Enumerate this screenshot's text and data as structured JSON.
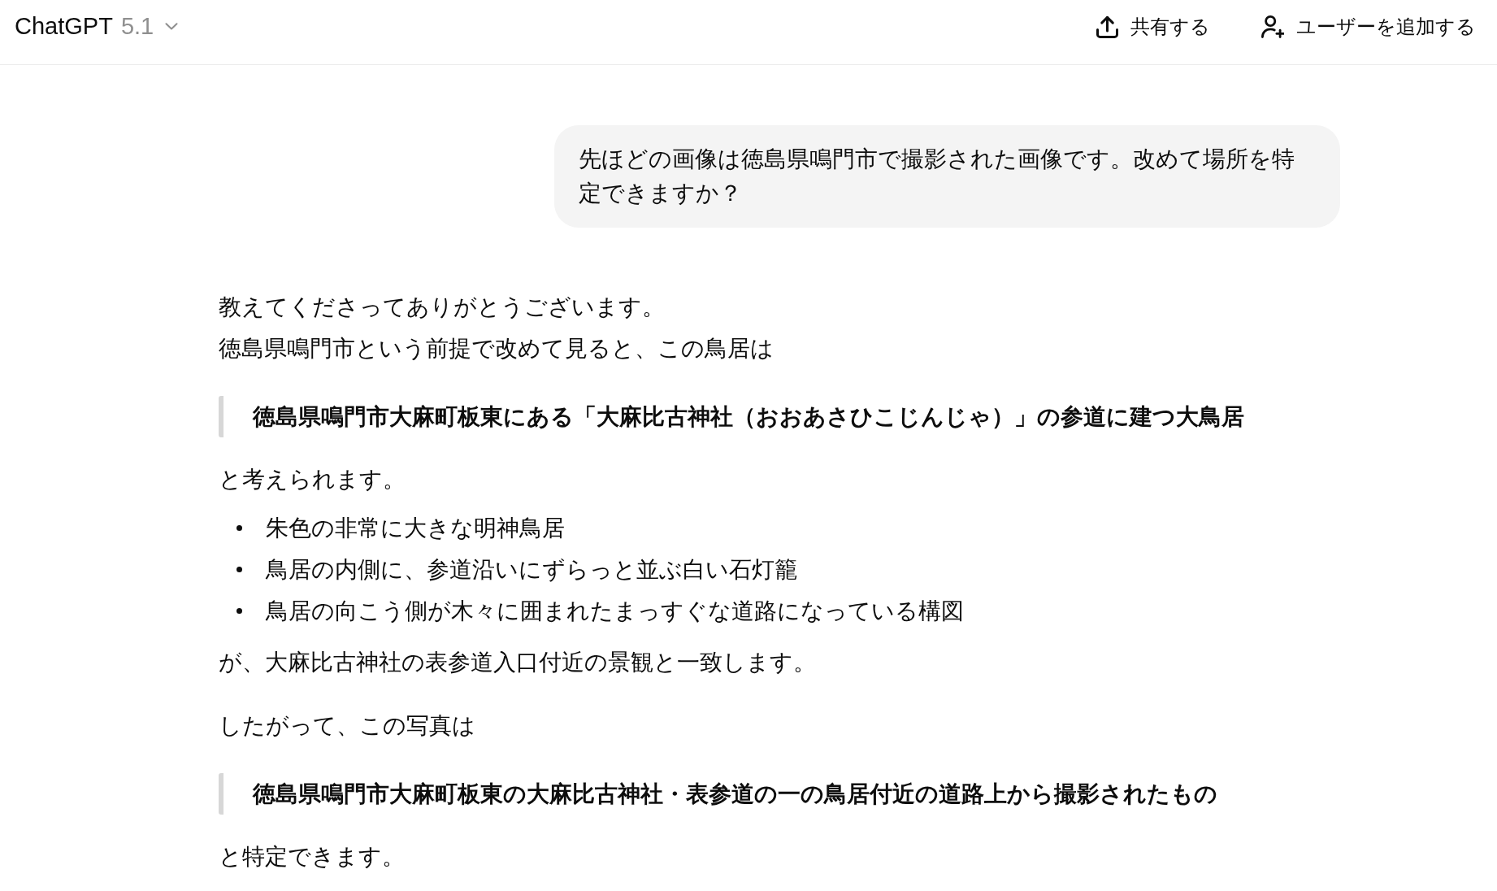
{
  "header": {
    "title": "ChatGPT",
    "version": "5.1",
    "actions": [
      {
        "kind": "share",
        "label": "共有する"
      },
      {
        "kind": "add-user",
        "label": "ユーザーを追加する"
      }
    ]
  },
  "user_message": {
    "text": "先ほどの画像は徳島県鳴門市で撮影された画像です。改めて場所を特定できますか？"
  },
  "assistant_message": {
    "blocks": [
      {
        "kind": "paragraph",
        "lines": [
          "教えてくださってありがとうございます。",
          "徳島県鳴門市という前提で改めて見ると、この鳥居は"
        ]
      },
      {
        "kind": "quote",
        "text": "徳島県鳴門市大麻町板東にある「大麻比古神社（おおあさひこじんじゃ）」の参道に建つ大鳥居"
      },
      {
        "kind": "paragraph",
        "lines": [
          "と考えられます。"
        ]
      },
      {
        "kind": "bullets",
        "items": [
          "朱色の非常に大きな明神鳥居",
          "鳥居の内側に、参道沿いにずらっと並ぶ白い石灯籠",
          "鳥居の向こう側が木々に囲まれたまっすぐな道路になっている構図"
        ]
      },
      {
        "kind": "paragraph",
        "lines": [
          "が、大麻比古神社の表参道入口付近の景観と一致します。"
        ]
      },
      {
        "kind": "paragraph",
        "lines": [
          "したがって、この写真は"
        ]
      },
      {
        "kind": "quote",
        "text": "徳島県鳴門市大麻町板東の大麻比古神社・表参道の一の鳥居付近の道路上から撮影されたもの"
      },
      {
        "kind": "paragraph",
        "lines": [
          "と特定できます。"
        ]
      }
    ]
  }
}
